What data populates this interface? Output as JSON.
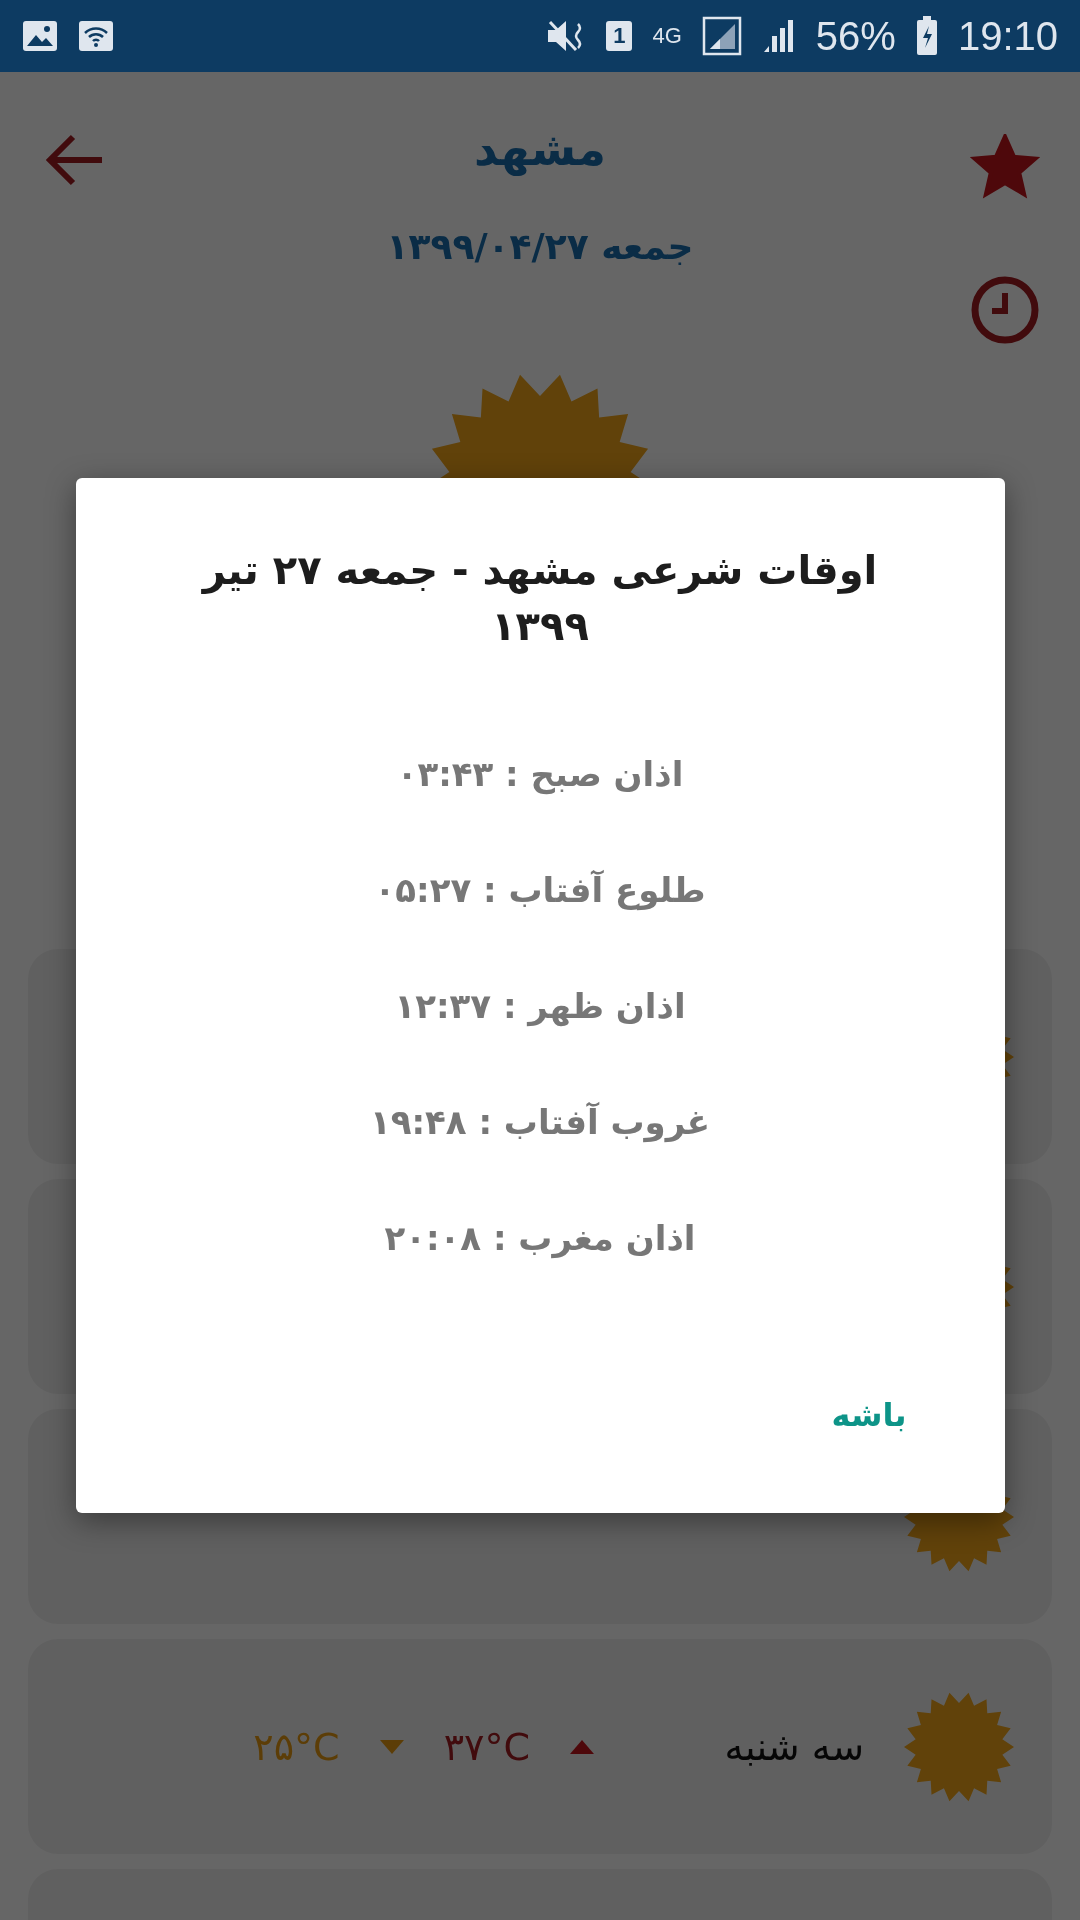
{
  "status_bar": {
    "sim": "1",
    "network": "4G",
    "battery": "56%",
    "time": "19:10"
  },
  "header": {
    "title": "مشهد",
    "date": "جمعه ۱۳۹۹/۰۴/۲۷",
    "favorite": true
  },
  "forecast": [
    {
      "kind": "sunny"
    },
    {
      "kind": "sunny"
    },
    {
      "kind": "sunny"
    },
    {
      "kind": "sunny"
    },
    {
      "kind": "sunny",
      "day": "سه شنبه",
      "high": "۳۷°C",
      "low": "۲۵°C"
    },
    {
      "kind": "cut_off"
    }
  ],
  "dialog": {
    "title": "اوقات شرعی مشهد - جمعه ۲۷ تیر ۱۳۹۹",
    "times": [
      "اذان صبح : ۰۳:۴۳",
      "طلوع آفتاب : ۰۵:۲۷",
      "اذان ظهر : ۱۲:۳۷",
      "غروب آفتاب : ۱۹:۴۸",
      "اذان مغرب : ۲۰:۰۸"
    ],
    "button": "باشه"
  }
}
